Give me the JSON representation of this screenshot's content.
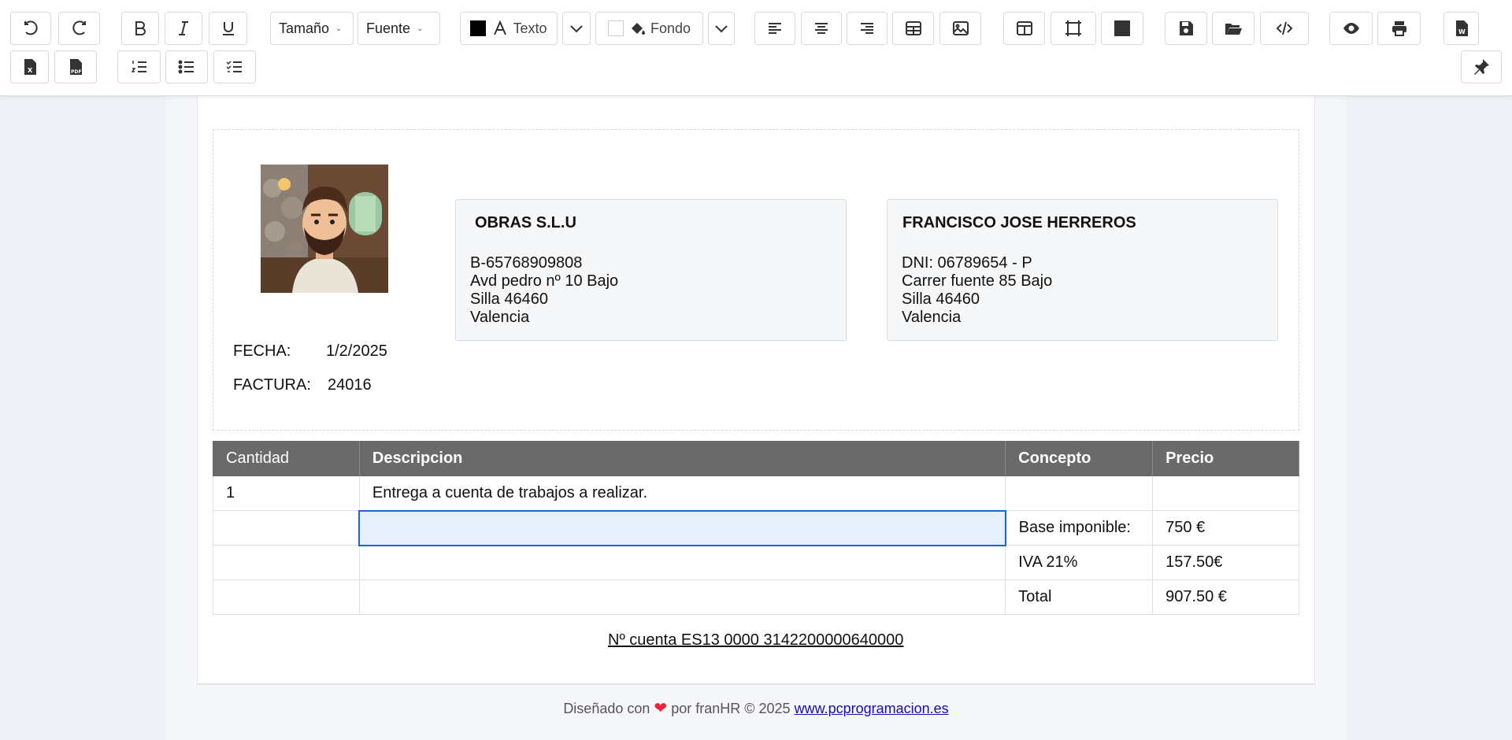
{
  "toolbar": {
    "size_label": "Tamaño",
    "font_label": "Fuente",
    "text_color_label": "Texto",
    "bg_color_label": "Fondo"
  },
  "invoice": {
    "date_label": "FECHA:",
    "date_value": "1/2/2025",
    "number_label": "FACTURA:",
    "number_value": "24016",
    "company": {
      "name": "OBRAS S.L.U",
      "cif": "B-65768909808",
      "address": "Avd pedro nº 10 Bajo",
      "city": "Silla 46460",
      "province": "Valencia"
    },
    "client": {
      "name": "FRANCISCO JOSE HERREROS",
      "dni": "DNI: 06789654 - P",
      "address": "Carrer fuente 85 Bajo",
      "city": "Silla 46460",
      "province": "Valencia"
    },
    "table": {
      "headers": [
        "Cantidad",
        "Descripcion",
        "Concepto",
        "Precio"
      ],
      "rows": [
        [
          "1",
          "Entrega a cuenta de trabajos a realizar.",
          "",
          ""
        ],
        [
          "",
          "",
          "Base imponible:",
          "750 €"
        ],
        [
          "",
          "",
          "IVA 21%",
          "157.50€"
        ],
        [
          "",
          "",
          "Total",
          "907.50 €"
        ]
      ]
    },
    "account": "Nº cuenta ES13 0000 3142200000640000"
  },
  "footer": {
    "prefix": "Diseñado con",
    "middle": "por franHR",
    "year": "2025",
    "link": "www.pcprogramacion.es"
  }
}
